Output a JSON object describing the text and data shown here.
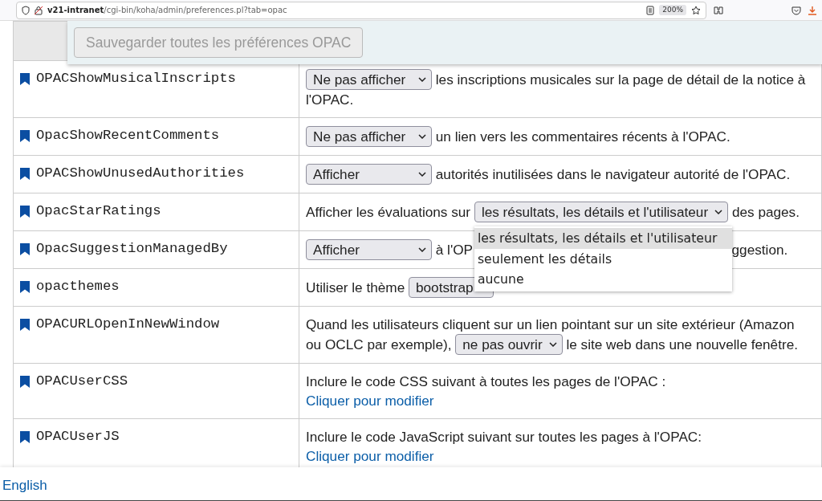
{
  "browser": {
    "url_host": "v21-intranet",
    "url_path": "/cgi-bin/koha/admin/preferences.pl?tab=opac",
    "zoom": "200%"
  },
  "save_button": {
    "label": "Sauvegarder toutes les préférences OPAC",
    "disabled": true
  },
  "preferences": [
    {
      "name": "OPACShowMusicalInscripts",
      "parts": [
        {
          "kind": "select",
          "value": "Ne pas afficher"
        },
        {
          "kind": "text",
          "text": "les inscriptions musicales sur la page de détail de la notice à"
        },
        {
          "kind": "text",
          "text": "l'OPAC."
        }
      ]
    },
    {
      "name": "OpacShowRecentComments",
      "parts": [
        {
          "kind": "select",
          "value": "Ne pas afficher"
        },
        {
          "kind": "text",
          "text": "un lien vers les commentaires récents à l'OPAC."
        }
      ]
    },
    {
      "name": "OPACShowUnusedAuthorities",
      "parts": [
        {
          "kind": "select",
          "value": "Afficher"
        },
        {
          "kind": "text",
          "text": "autorités inutilisées dans le navigateur autorité de l'OPAC."
        }
      ]
    },
    {
      "name": "OpacStarRatings",
      "parts": [
        {
          "kind": "text",
          "text": "Afficher les évaluations sur"
        },
        {
          "kind": "select",
          "value": "les résultats, les détails et l'utilisateur",
          "options": [
            {
              "label": "les résultats, les détails et l'utilisateur",
              "selected": true
            },
            {
              "label": "seulement les détails",
              "selected": false
            },
            {
              "label": "aucune",
              "selected": false
            }
          ]
        },
        {
          "kind": "text",
          "text": "des pages."
        }
      ]
    },
    {
      "name": "OpacSuggestionManagedBy",
      "parts": [
        {
          "kind": "select",
          "value": "Afficher"
        },
        {
          "kind": "text",
          "text": "à l'OP"
        },
        {
          "kind": "covered"
        },
        {
          "kind": "text",
          "text": "ggestion."
        }
      ]
    },
    {
      "name": "opacthemes",
      "parts": [
        {
          "kind": "text",
          "text": "Utiliser le thème"
        },
        {
          "kind": "select",
          "value": "bootstrap"
        }
      ]
    },
    {
      "name": "OPACURLOpenInNewWindow",
      "parts": [
        {
          "kind": "text",
          "text": "Quand les utilisateurs cliquent sur un lien pointant sur un site extérieur (Amazon"
        },
        {
          "kind": "text",
          "text": "ou OCLC par exemple),"
        },
        {
          "kind": "select",
          "value": "ne pas ouvrir"
        },
        {
          "kind": "text",
          "text": "le site web dans une nouvelle fenêtre."
        }
      ]
    },
    {
      "name": "OPACUserCSS",
      "parts": [
        {
          "kind": "text",
          "text": "Inclure le code CSS suivant à toutes les pages de l'OPAC :"
        },
        {
          "kind": "link",
          "text": "Cliquer pour modifier"
        }
      ]
    },
    {
      "name": "OPACUserJS",
      "parts": [
        {
          "kind": "text",
          "text": "Inclure le code JavaScript suivant sur toutes les pages à l'OPAC:"
        },
        {
          "kind": "link",
          "text": "Cliquer pour modifier"
        }
      ]
    }
  ],
  "footer": {
    "language_link": "English"
  }
}
